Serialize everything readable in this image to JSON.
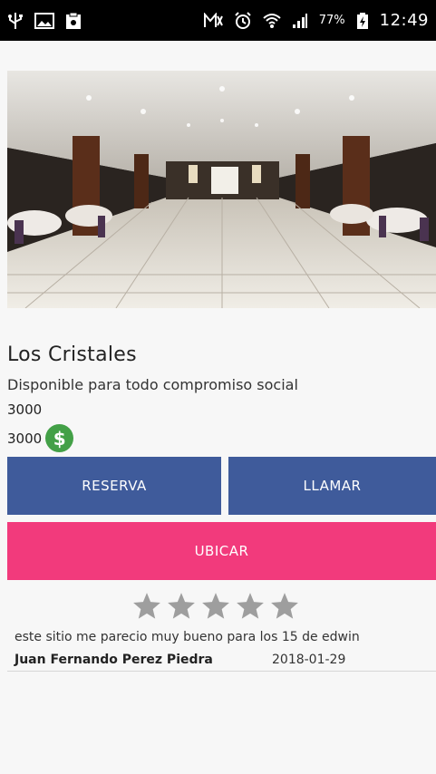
{
  "status_bar": {
    "battery": "77%",
    "time": "12:49",
    "icons": [
      "usb-icon",
      "image-icon",
      "clipboard-icon",
      "mute-icon",
      "alarm-icon",
      "wifi-icon",
      "signal-icon",
      "battery-charging-icon"
    ]
  },
  "venue": {
    "name": "Los Cristales",
    "description": "Disponible para todo compromiso social",
    "capacity": "3000",
    "price": "3000",
    "price_icon": "dollar-icon"
  },
  "actions": {
    "reserva_label": "RESERVA",
    "llamar_label": "LLAMAR",
    "ubicar_label": "UBICAR"
  },
  "colors": {
    "primary_button": "#3f5b9b",
    "accent_button": "#f23a7c",
    "price_icon": "#43a047",
    "star": "#9e9e9e"
  },
  "review": {
    "rating": 0,
    "max_rating": 5,
    "text": "este sitio me parecio muy bueno para los 15 de edwin",
    "author": "Juan Fernando Perez Piedra",
    "date": "2018-01-29"
  }
}
